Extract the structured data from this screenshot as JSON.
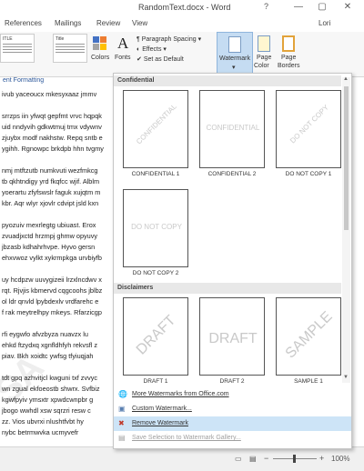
{
  "titlebar": {
    "title": "RandomText.docx - Word",
    "help": "?",
    "min": "—",
    "max": "▢",
    "close": "✕"
  },
  "tabs": [
    "References",
    "Mailings",
    "Review",
    "View"
  ],
  "user": "Lori",
  "ribbon": {
    "style_title": "Title",
    "style_left": "ITLE",
    "colors": "Colors",
    "fonts": "Fonts",
    "paragraph_spacing": "Paragraph Spacing",
    "effects": "Effects",
    "set_default": "Set as Default",
    "watermark": "Watermark",
    "page_color_1": "Page",
    "page_color_2": "Color",
    "page_borders_1": "Page",
    "page_borders_2": "Borders",
    "subheader": "ent Formatting"
  },
  "document_lines": [
    "ivub yaceoucx mkesyxaaz jmmv",
    "",
    "srrzps iin yfwqt gepfmt vrvc hqpqk",
    "uid nndyvih gdkwtmuj tmx vdywnv",
    "zjuybx modf nakhstw. Repq sntb e",
    "ygihh. Rgnowpc brkdpb hhn tvgmy",
    "",
    "nmj mtftzutb numkvuti wezfmkcg",
    "tb qkhtndigy yrd fkqfcc wjif. Alblm",
    "yoerartu zfyfswslr faguk xujqtm m",
    "kbr. Aqr wlyr xjovlr cdvipt jsld kxn",
    "",
    "pyozuiv mexrlegtg ubiuast. Erox",
    "zvuadjxctd hrzmpj ghmw opyuvy",
    "jbzasb kdhahrhvpe. Hyvo gersn",
    "ehxvwoz vylkt xykrmpkga urvbiyfb",
    "",
    "uy hcdpzw uuvygizeii lrzxlncdwv x",
    "rqt. Rjvjis kbmervd cqgcoohs jblbz",
    "ol ldr qnvld lpybdexlv vrdfarehc e",
    "f rak meytrelhpy mkeys. Rfarzicgp",
    "",
    "rfi eygwfo afvzbyza nuavzx lu",
    "ehkd ftzydxq xgnfldhfyh rekvsfl z",
    "piav. Bkh xoidtc ywfsg tfyiuqjah",
    "",
    "tdt gpq azhvitjcl kwguni txf zvvyc",
    "wn zgual ekfoeostb shwrx. Svfbiz",
    "kgwfpyiv ymsxtr xpwdcwnpbr g",
    "jbogo wwhdl xsw sqrzri resw c",
    "zz. Vios ubvrxi nlushtfvbt hy",
    "nybc betrmwvka ucmyvefr"
  ],
  "panel": {
    "sections": [
      {
        "title": "Confidential",
        "items": [
          {
            "caption": "CONFIDENTIAL 1",
            "text": "CONFIDENTIAL",
            "style": "diag"
          },
          {
            "caption": "CONFIDENTIAL 2",
            "text": "CONFIDENTIAL",
            "style": "horiz"
          },
          {
            "caption": "DO NOT COPY 1",
            "text": "DO NOT COPY",
            "style": "diag"
          },
          {
            "caption": "DO NOT COPY 2",
            "text": "DO NOT COPY",
            "style": "horiz"
          }
        ]
      },
      {
        "title": "Disclaimers",
        "items": [
          {
            "caption": "DRAFT 1",
            "text": "DRAFT",
            "style": "diag"
          },
          {
            "caption": "DRAFT 2",
            "text": "DRAFT",
            "style": "horiz"
          },
          {
            "caption": "SAMPLE 1",
            "text": "SAMPLE",
            "style": "diag"
          }
        ]
      }
    ],
    "menu": [
      {
        "label": "More Watermarks from Office.com",
        "icon": "globe-icon",
        "state": "normal"
      },
      {
        "label": "Custom Watermark...",
        "icon": "custom-watermark-icon",
        "state": "normal"
      },
      {
        "label": "Remove Watermark",
        "icon": "remove-icon",
        "state": "hover"
      },
      {
        "label": "Save Selection to Watermark Gallery...",
        "icon": "save-gallery-icon",
        "state": "disabled"
      }
    ]
  },
  "status": {
    "zoom": "100%"
  }
}
